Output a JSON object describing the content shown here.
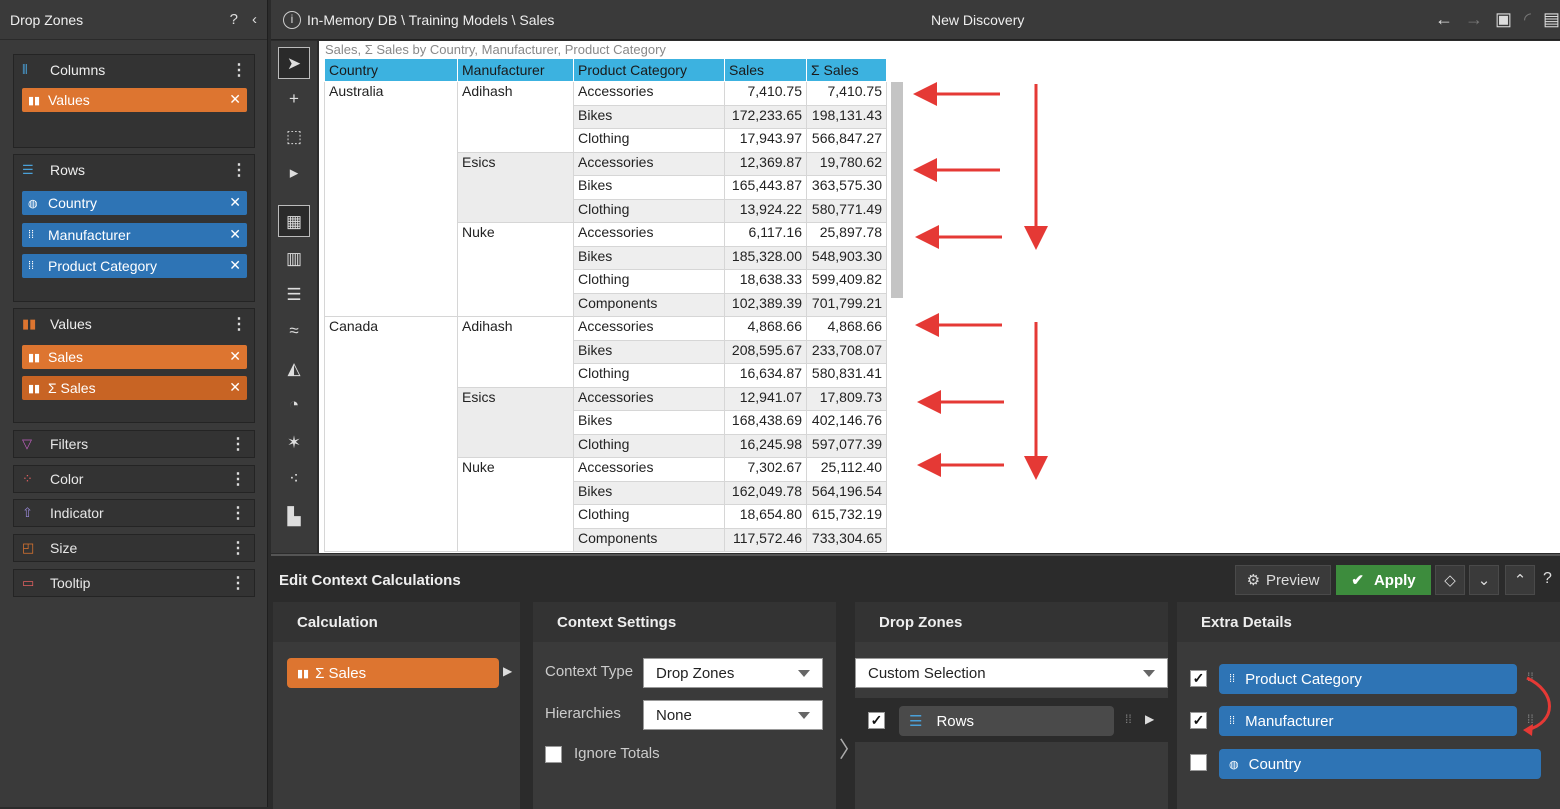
{
  "left_panel": {
    "title": "Drop Zones",
    "help_icon": "?",
    "collapse_icon": "‹",
    "columns": {
      "label": "Columns",
      "chips": [
        {
          "label": "Values"
        }
      ]
    },
    "rows": {
      "label": "Rows",
      "chips": [
        {
          "label": "Country"
        },
        {
          "label": "Manufacturer"
        },
        {
          "label": "Product Category"
        }
      ]
    },
    "values": {
      "label": "Values",
      "chips": [
        {
          "label": "Sales"
        },
        {
          "label": "Σ Sales"
        }
      ]
    },
    "filters": {
      "label": "Filters"
    },
    "color": {
      "label": "Color"
    },
    "indicator": {
      "label": "Indicator"
    },
    "size": {
      "label": "Size"
    },
    "tooltip": {
      "label": "Tooltip"
    }
  },
  "topbar": {
    "info_icon": "i",
    "path": "In-Memory DB \\ Training Models \\ Sales",
    "title": "New Discovery"
  },
  "grid": {
    "title": "Sales, Σ Sales by Country, Manufacturer, Product Category",
    "headers": [
      "Country",
      "Manufacturer",
      "Product Category",
      "Sales",
      "Σ Sales"
    ],
    "rows": [
      [
        "Australia",
        "Adihash",
        "Accessories",
        "7,410.75",
        "7,410.75"
      ],
      [
        "",
        "",
        "Bikes",
        "172,233.65",
        "198,131.43"
      ],
      [
        "",
        "",
        "Clothing",
        "17,943.97",
        "566,847.27"
      ],
      [
        "",
        "Esics",
        "Accessories",
        "12,369.87",
        "19,780.62"
      ],
      [
        "",
        "",
        "Bikes",
        "165,443.87",
        "363,575.30"
      ],
      [
        "",
        "",
        "Clothing",
        "13,924.22",
        "580,771.49"
      ],
      [
        "",
        "Nuke",
        "Accessories",
        "6,117.16",
        "25,897.78"
      ],
      [
        "",
        "",
        "Bikes",
        "185,328.00",
        "548,903.30"
      ],
      [
        "",
        "",
        "Clothing",
        "18,638.33",
        "599,409.82"
      ],
      [
        "",
        "",
        "Components",
        "102,389.39",
        "701,799.21"
      ],
      [
        "Canada",
        "Adihash",
        "Accessories",
        "4,868.66",
        "4,868.66"
      ],
      [
        "",
        "",
        "Bikes",
        "208,595.67",
        "233,708.07"
      ],
      [
        "",
        "",
        "Clothing",
        "16,634.87",
        "580,831.41"
      ],
      [
        "",
        "Esics",
        "Accessories",
        "12,941.07",
        "17,809.73"
      ],
      [
        "",
        "",
        "Bikes",
        "168,438.69",
        "402,146.76"
      ],
      [
        "",
        "",
        "Clothing",
        "16,245.98",
        "597,077.39"
      ],
      [
        "",
        "Nuke",
        "Accessories",
        "7,302.67",
        "25,112.40"
      ],
      [
        "",
        "",
        "Bikes",
        "162,049.78",
        "564,196.54"
      ],
      [
        "",
        "",
        "Clothing",
        "18,654.80",
        "615,732.19"
      ],
      [
        "",
        "",
        "Components",
        "117,572.46",
        "733,304.65"
      ]
    ]
  },
  "bottom": {
    "title": "Edit Context Calculations",
    "preview_label": "Preview",
    "apply_label": "Apply",
    "help_label": "?",
    "calculation": {
      "header": "Calculation",
      "item": "Σ Sales"
    },
    "context_settings": {
      "header": "Context Settings",
      "context_type_label": "Context Type",
      "context_type_value": "Drop Zones",
      "hierarchies_label": "Hierarchies",
      "hierarchies_value": "None",
      "ignore_totals_label": "Ignore Totals"
    },
    "drop_zones": {
      "header": "Drop Zones",
      "selection": "Custom Selection",
      "item": "Rows"
    },
    "extra_details": {
      "header": "Extra Details",
      "items": [
        {
          "label": "Product Category",
          "checked": true
        },
        {
          "label": "Manufacturer",
          "checked": true
        },
        {
          "label": "Country",
          "checked": false
        }
      ]
    }
  },
  "colors": {
    "accent_orange": "#dd7530",
    "accent_blue": "#2e74b5",
    "apply_green": "#3d8c3d",
    "header_cyan": "#3cb2e0",
    "arrow_red": "#e53935"
  }
}
